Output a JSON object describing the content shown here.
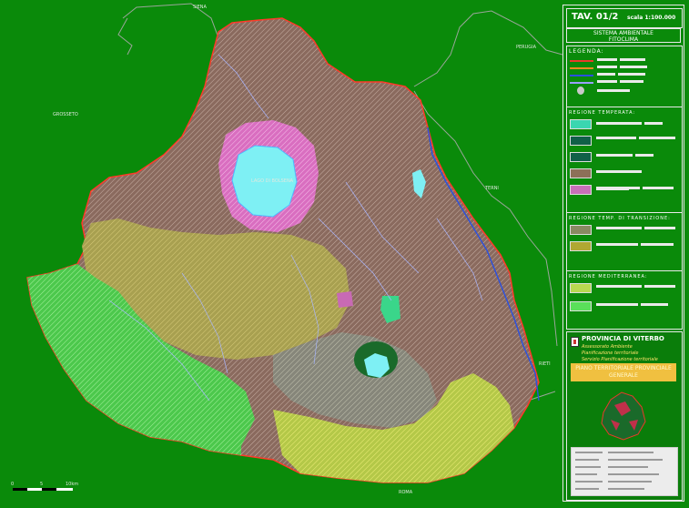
{
  "map": {
    "places": [
      {
        "id": "siena",
        "label": "SIENA"
      },
      {
        "id": "perugia",
        "label": "PERUGIA"
      },
      {
        "id": "grosseto",
        "label": "GROSSETO"
      },
      {
        "id": "terni",
        "label": "TERNI"
      },
      {
        "id": "rieti",
        "label": "RIETI"
      },
      {
        "id": "roma",
        "label": "ROMA"
      },
      {
        "id": "lake",
        "label": "LAGO DI BOLSENA"
      }
    ],
    "scale_bar": {
      "zero": "0",
      "mid": "5",
      "end": "10km"
    }
  },
  "panel": {
    "code": "TAV. 01/2",
    "scale": "scala 1:100.000",
    "title_line1": "SISTEMA AMBIENTALE",
    "title_line2": "FITOCLIMA",
    "legend_title": "LEGENDA:",
    "sections": {
      "temperate": "REGIONE TEMPERATA:",
      "transition": "REGIONE TEMP. DI TRANSIZIONE:",
      "mediterranean": "REGIONE MEDITERRANEA:"
    },
    "line_colors": [
      "#e83a2a",
      "#f08a20",
      "#2a50e0",
      "#9aa0ff"
    ],
    "swatch_colors": [
      "#3ad6b0",
      "#106048",
      "#8c7058",
      "#c870b8",
      "#8a8a62",
      "#b0a832",
      "#b8d850",
      "#5ae05a"
    ],
    "province": {
      "name": "PROVINCIA DI VITERBO",
      "line1": "Assessorato Ambiente",
      "line2": "Pianificazione territoriale",
      "line3": "Servizio Pianificazione territoriale",
      "plan_line1": "PIANO TERRITORIALE PROVINCIALE",
      "plan_line2": "GENERALE"
    }
  },
  "colors": {
    "background": "#0a8a0a",
    "region_border": "#ff3a2a",
    "lake": "#7ef0f4",
    "temperate_fill": "#8a6a5e",
    "transition_fill": "#a8a050",
    "mediterranean_fill": "#5ad85a",
    "pink_zone": "#d96ec0",
    "yellow_zone": "#c8d050"
  }
}
